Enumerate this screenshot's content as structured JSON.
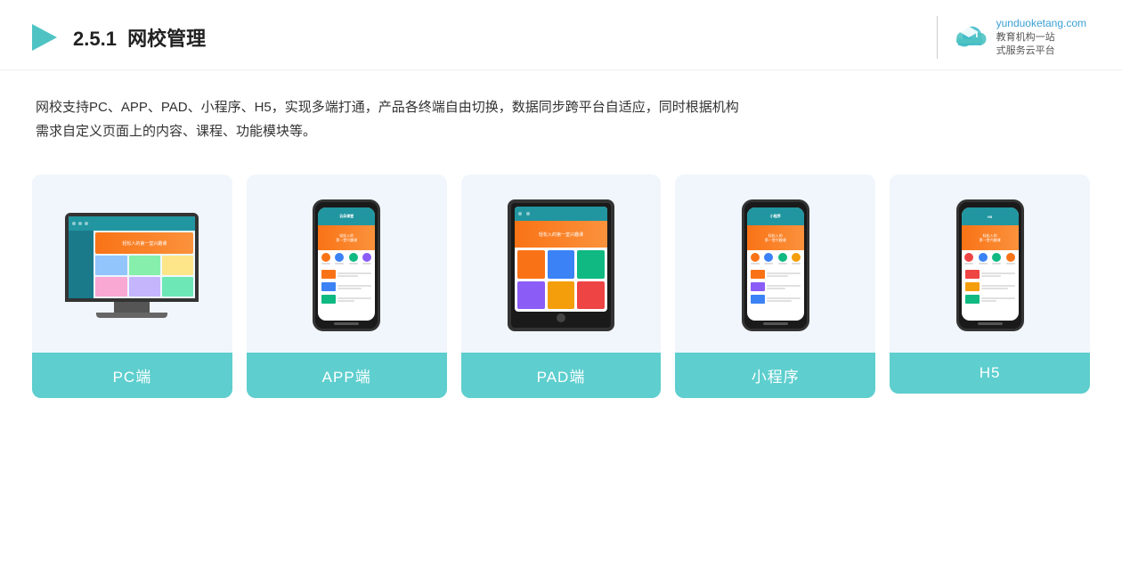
{
  "header": {
    "section_number": "2.5.1",
    "title_normal": "",
    "title_bold": "网校管理",
    "logo_site": "yunduoketang.com",
    "logo_line1": "教育机构一站",
    "logo_line2": "式服务云平台"
  },
  "description": {
    "text1": "网校支持PC、APP、PAD、小程序、H5，实现多端打通，产品各终端自由切换，数据同步跨平台自适应，同时根据机构",
    "text2": "需求自定义页面上的内容、课程、功能模块等。"
  },
  "cards": [
    {
      "id": "pc",
      "label": "PC端"
    },
    {
      "id": "app",
      "label": "APP端"
    },
    {
      "id": "pad",
      "label": "PAD端"
    },
    {
      "id": "miniprogram",
      "label": "小程序"
    },
    {
      "id": "h5",
      "label": "H5"
    }
  ],
  "colors": {
    "teal": "#5ecece",
    "dark_teal": "#2196a0",
    "orange": "#f97316",
    "accent_blue": "#3b82f6",
    "bg_card": "#f0f5fa"
  }
}
